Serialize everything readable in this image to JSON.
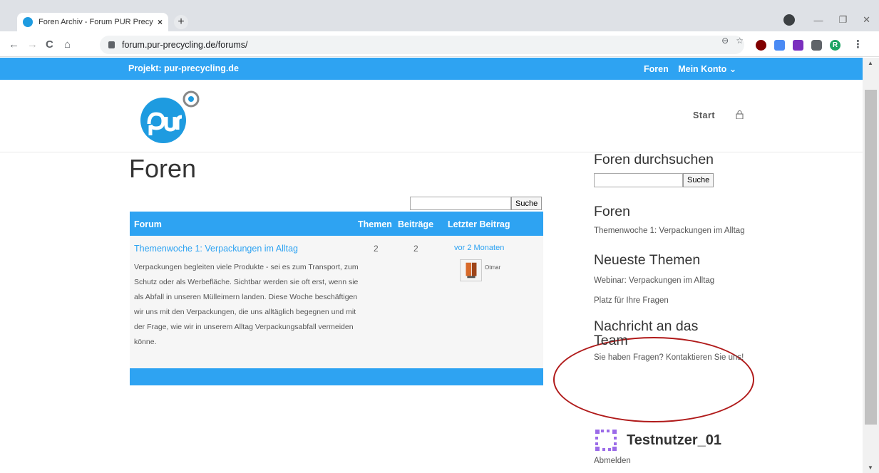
{
  "browser": {
    "tab_title": "Foren Archiv - Forum PUR Precyc",
    "tab_close": "×",
    "new_tab": "+",
    "url": "forum.pur-precycling.de/forums/",
    "profile_initial": "R",
    "nav_back": "←",
    "nav_forward": "→",
    "nav_reload": "C",
    "nav_home": "⌂",
    "zoom": "⊖",
    "star": "☆",
    "kebab": "⋮",
    "win_min": "—",
    "win_restore": "❐",
    "win_close": "✕"
  },
  "topbar": {
    "project": "Projekt: pur-precycling.de",
    "menu_forums": "Foren",
    "menu_account": "Mein Konto ⌄"
  },
  "header": {
    "nav_start": "Start"
  },
  "page": {
    "title": "Foren"
  },
  "forum_search": {
    "button": "Suche"
  },
  "forum_table": {
    "headers": [
      "Forum",
      "Themen",
      "Beiträge",
      "Letzter Beitrag"
    ],
    "rows": [
      {
        "title": "Themenwoche 1: Verpackungen im Alltag",
        "description": "Verpackungen begleiten viele Produkte - sei es zum Transport, zum Schutz oder als Werbefläche. Sichtbar werden sie oft erst, wenn sie als Abfall in unseren Mülleimern landen. Diese Woche beschäftigen wir uns mit den Verpackungen, die uns alltäglich begegnen und mit der Frage, wie wir in unserem Alltag Verpackungsabfall vermeiden könne.",
        "topics": "2",
        "posts": "2",
        "last_post": "vor 2 Monaten",
        "author": "Otmar"
      }
    ]
  },
  "sidebar": {
    "search_title": "Foren durchsuchen",
    "search_button": "Suche",
    "forums_title": "Foren",
    "forums_link": "Themenwoche 1: Verpackungen im Alltag",
    "newest_title": "Neueste Themen",
    "newest": [
      "Webinar: Verpackungen im Alltag",
      "Platz für Ihre Fragen"
    ],
    "contact_title": "Nachricht an das Team",
    "contact_text": "Sie haben Fragen? Kontaktieren Sie uns!",
    "username": "Testnutzer_01",
    "logout": "Abmelden"
  },
  "colors": {
    "accent": "#2ea3f2",
    "annotation": "#b01a1a"
  }
}
